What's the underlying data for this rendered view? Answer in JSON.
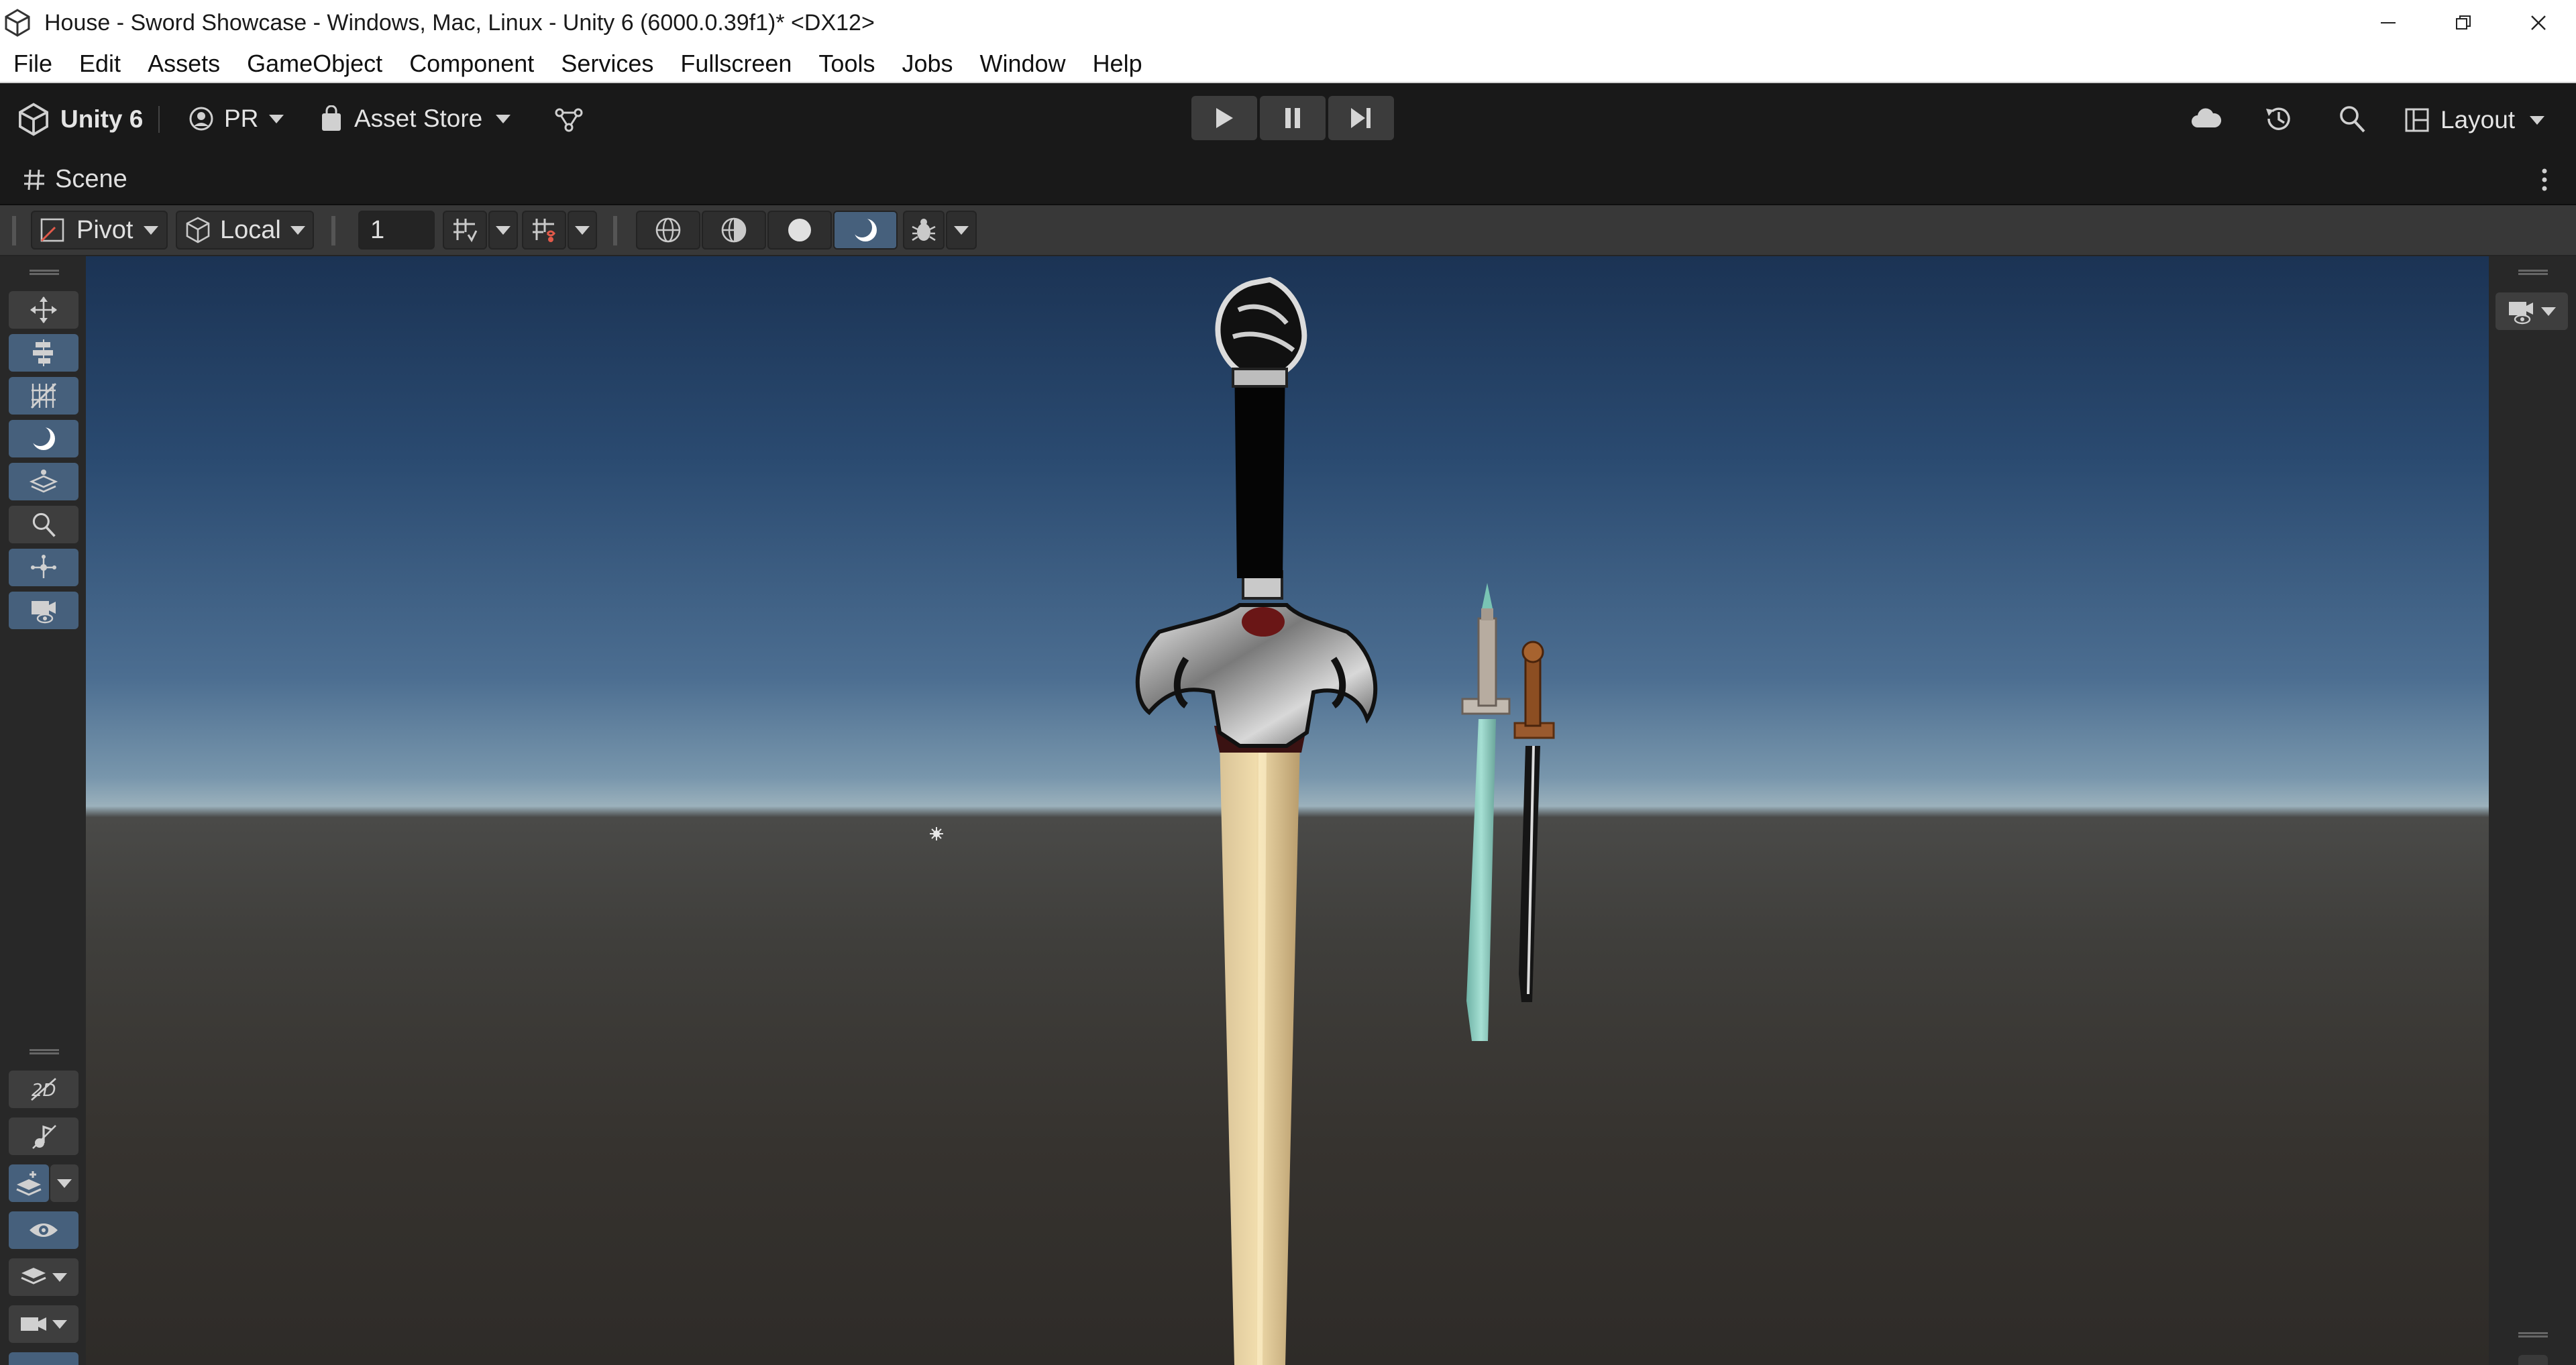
{
  "window": {
    "title": "House - Sword Showcase - Windows, Mac, Linux - Unity 6 (6000.0.39f1)* <DX12>"
  },
  "menu": {
    "items": [
      "File",
      "Edit",
      "Assets",
      "GameObject",
      "Component",
      "Services",
      "Fullscreen",
      "Tools",
      "Jobs",
      "Window",
      "Help"
    ]
  },
  "toolbar": {
    "product_label": "Unity 6",
    "account_label": "PR",
    "asset_store_label": "Asset Store",
    "layout_label": "Layout"
  },
  "scene_tab": {
    "label": "Scene"
  },
  "scene_toolbar": {
    "pivot_label": "Pivot",
    "space_label": "Local",
    "grid_increment_value": "1"
  },
  "colors": {
    "accent_blue": "#46607c",
    "panel_dark": "#191919",
    "panel_mid": "#383838"
  }
}
